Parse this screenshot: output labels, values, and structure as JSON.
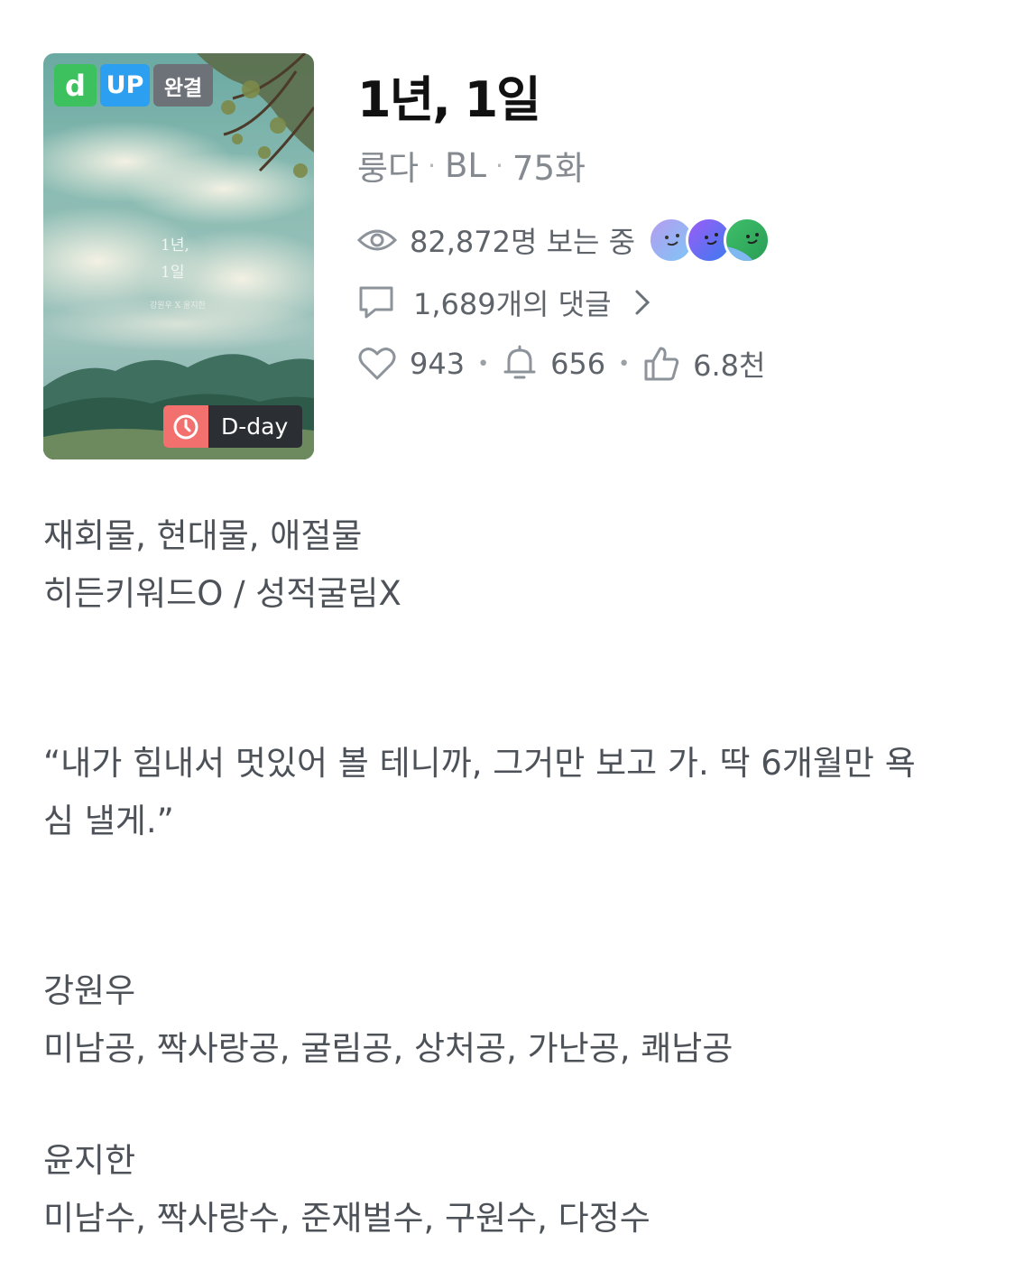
{
  "cover": {
    "badges": {
      "d": "d",
      "up": "UP",
      "status": "완결"
    },
    "title_line1": "1년,",
    "title_line2": "1일",
    "authors_text": "강원우 X 윤지한",
    "dday_label": "D-day"
  },
  "work": {
    "title": "1년, 1일",
    "author": "룽다",
    "genre": "BL",
    "episodes": "75화"
  },
  "stats": {
    "viewing_now": "82,872명 보는 중",
    "comments": "1,689개의 댓글",
    "hearts": "943",
    "alarms": "656",
    "likes": "6.8천"
  },
  "description": {
    "tags_line1": "재회물, 현대물, 애절물",
    "tags_line2": "히든키워드O / 성적굴림X",
    "quote_line1": "“내가 힘내서 멋있어 볼 테니까, 그거만 보고 가. 딱 6개월만 욕",
    "quote_line2": "심 낼게.”",
    "char1_name": "강원우",
    "char1_tags": "미남공, 짝사랑공, 굴림공, 상처공, 가난공, 쾌남공",
    "char2_name": "윤지한",
    "char2_tags": "미남수, 짝사랑수, 준재벌수, 구원수, 다정수"
  },
  "colors": {
    "badge_d": "#3dc15e",
    "badge_up": "#2c9ff0",
    "badge_done": "#6d7178",
    "dday_clock": "#f2706e"
  },
  "icons": [
    "eye-icon",
    "comment-icon",
    "chevron-right-icon",
    "heart-icon",
    "bell-icon",
    "thumbs-up-icon",
    "clock-icon"
  ]
}
